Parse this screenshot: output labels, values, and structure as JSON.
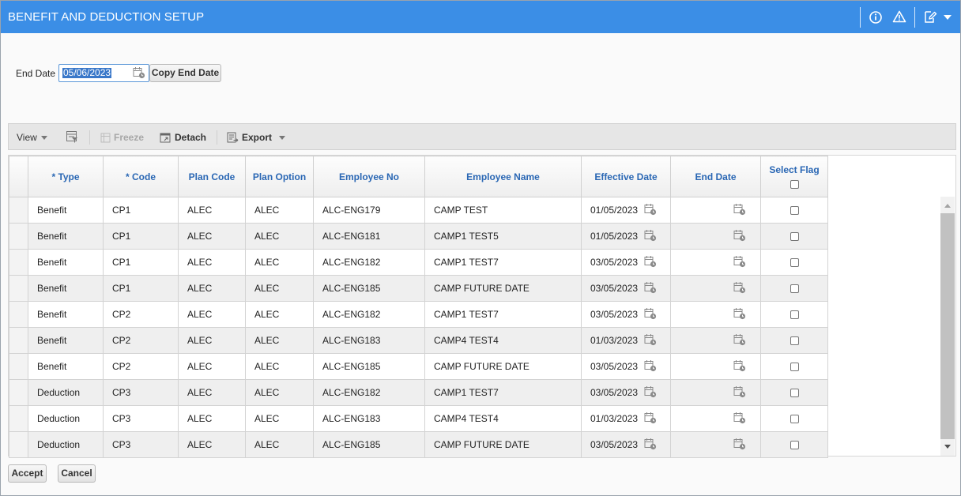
{
  "window": {
    "title": "BENEFIT AND DEDUCTION SETUP"
  },
  "colors": {
    "titlebar": "#3b8ee6",
    "header_text": "#2a67b4",
    "selection": "#3a78c9"
  },
  "titlebar_icons": [
    "info-icon",
    "warning-icon",
    "edit-note-icon",
    "dropdown-caret-icon"
  ],
  "form": {
    "end_date_label": "End Date",
    "end_date_value": "05/06/2023",
    "copy_button": "Copy End Date"
  },
  "toolbar": {
    "view": "View",
    "freeze": "Freeze",
    "detach": "Detach",
    "export": "Export"
  },
  "grid": {
    "columns": {
      "type": "* Type",
      "code": "* Code",
      "plan_code": "Plan Code",
      "plan_option": "Plan Option",
      "employee_no": "Employee No",
      "employee_name": "Employee Name",
      "effective_date": "Effective Date",
      "end_date": "End Date",
      "select_flag": "Select Flag"
    },
    "rows": [
      {
        "type": "Benefit",
        "code": "CP1",
        "plan_code": "ALEC",
        "plan_option": "ALEC",
        "employee_no": "ALC-ENG179",
        "employee_name": "CAMP TEST",
        "effective_date": "01/05/2023",
        "end_date": ""
      },
      {
        "type": "Benefit",
        "code": "CP1",
        "plan_code": "ALEC",
        "plan_option": "ALEC",
        "employee_no": "ALC-ENG181",
        "employee_name": "CAMP1 TEST5",
        "effective_date": "01/05/2023",
        "end_date": ""
      },
      {
        "type": "Benefit",
        "code": "CP1",
        "plan_code": "ALEC",
        "plan_option": "ALEC",
        "employee_no": "ALC-ENG182",
        "employee_name": "CAMP1 TEST7",
        "effective_date": "03/05/2023",
        "end_date": ""
      },
      {
        "type": "Benefit",
        "code": "CP1",
        "plan_code": "ALEC",
        "plan_option": "ALEC",
        "employee_no": "ALC-ENG185",
        "employee_name": "CAMP FUTURE DATE",
        "effective_date": "03/05/2023",
        "end_date": ""
      },
      {
        "type": "Benefit",
        "code": "CP2",
        "plan_code": "ALEC",
        "plan_option": "ALEC",
        "employee_no": "ALC-ENG182",
        "employee_name": "CAMP1 TEST7",
        "effective_date": "03/05/2023",
        "end_date": ""
      },
      {
        "type": "Benefit",
        "code": "CP2",
        "plan_code": "ALEC",
        "plan_option": "ALEC",
        "employee_no": "ALC-ENG183",
        "employee_name": "CAMP4 TEST4",
        "effective_date": "01/03/2023",
        "end_date": ""
      },
      {
        "type": "Benefit",
        "code": "CP2",
        "plan_code": "ALEC",
        "plan_option": "ALEC",
        "employee_no": "ALC-ENG185",
        "employee_name": "CAMP FUTURE DATE",
        "effective_date": "03/05/2023",
        "end_date": ""
      },
      {
        "type": "Deduction",
        "code": "CP3",
        "plan_code": "ALEC",
        "plan_option": "ALEC",
        "employee_no": "ALC-ENG182",
        "employee_name": "CAMP1 TEST7",
        "effective_date": "03/05/2023",
        "end_date": ""
      },
      {
        "type": "Deduction",
        "code": "CP3",
        "plan_code": "ALEC",
        "plan_option": "ALEC",
        "employee_no": "ALC-ENG183",
        "employee_name": "CAMP4 TEST4",
        "effective_date": "01/03/2023",
        "end_date": ""
      },
      {
        "type": "Deduction",
        "code": "CP3",
        "plan_code": "ALEC",
        "plan_option": "ALEC",
        "employee_no": "ALC-ENG185",
        "employee_name": "CAMP FUTURE DATE",
        "effective_date": "03/05/2023",
        "end_date": ""
      }
    ]
  },
  "footer": {
    "accept": "Accept",
    "cancel": "Cancel"
  }
}
